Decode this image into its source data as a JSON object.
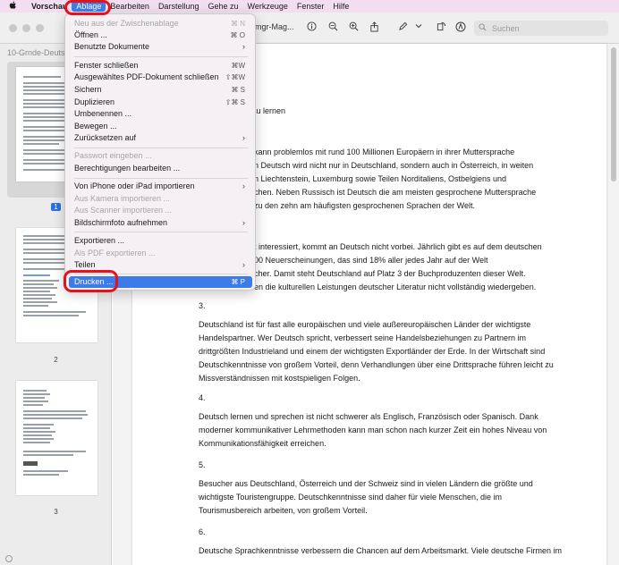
{
  "menubar": {
    "apple_icon": "apple-logo",
    "items": [
      "Vorschau",
      "Ablage",
      "Bearbeiten",
      "Darstellung",
      "Gehe zu",
      "Werkzeuge",
      "Fenster",
      "Hilfe"
    ]
  },
  "window": {
    "title": "mgr-Mag...",
    "search_placeholder": "Suchen"
  },
  "sidebar": {
    "title": "10-Grnde-Deuts",
    "pages": [
      "1",
      "2",
      "3"
    ]
  },
  "menu": {
    "neu": {
      "label": "Neu aus der Zwischenablage",
      "shortcut": "⌘ N"
    },
    "oeffnen": {
      "label": "Öffnen ...",
      "shortcut": "⌘ O"
    },
    "benutzte": {
      "label": "Benutzte Dokumente",
      "arrow": "›"
    },
    "fenster": {
      "label": "Fenster schließen",
      "shortcut": "⌘W"
    },
    "pdf_schliessen": {
      "label": "Ausgewähltes PDF-Dokument schließen",
      "shortcut": "⇧⌘W"
    },
    "sichern": {
      "label": "Sichern",
      "shortcut": "⌘ S"
    },
    "duplizieren": {
      "label": "Duplizieren",
      "shortcut": "⇧⌘ S"
    },
    "umbenennen": {
      "label": "Umbenennen ..."
    },
    "bewegen": {
      "label": "Bewegen ..."
    },
    "zuruecksetzen": {
      "label": "Zurücksetzen auf",
      "arrow": "›"
    },
    "passwort": {
      "label": "Passwort eingeben ..."
    },
    "berechtigungen": {
      "label": "Berechtigungen bearbeiten ..."
    },
    "iphone": {
      "label": "Von iPhone oder iPad importieren",
      "arrow": "›"
    },
    "kamera": {
      "label": "Aus Kamera importieren ..."
    },
    "scanner": {
      "label": "Aus Scanner importieren ..."
    },
    "bildschirmfoto": {
      "label": "Bildschirmfoto aufnehmen",
      "arrow": "›"
    },
    "exportieren": {
      "label": "Exportieren ..."
    },
    "als_pdf": {
      "label": "Als PDF exportieren ..."
    },
    "teilen": {
      "label": "Teilen",
      "arrow": "›"
    },
    "drucken": {
      "label": "Drucken ...",
      "shortcut": "⌘ P"
    }
  },
  "doc": {
    "l1": "zu lernen",
    "l2": "kann problemlos mit rund 100 Millionen Europäern in ihrer Muttersprache",
    "l3": "n Deutsch wird nicht nur in Deutschland, sondern auch in Österreich, in weiten",
    "l4": "n Liechtenstein, Luxemburg sowie Teilen Norditaliens, Ostbelgiens und",
    "l5": "chen. Neben Russisch ist Deutsch die am meisten gesprochene Muttersprache",
    "l6": "zu den zehn am häufigsten gesprochenen Sprachen der Welt.",
    "l7": "t interessiert, kommt an Deutsch nicht vorbei. Jährlich gibt es auf dem deutschen",
    "l8": "00 Neuerscheinungen, das sind 18% aller jedes Jahr auf der Welt",
    "l9": "cher. Damit steht Deutschland auf Platz 3 der Buchproduzenten dieser Welt.",
    "l10": "en die kulturellen Leistungen deutscher Literatur nicht vollständig wiedergeben.",
    "n3": "3.",
    "p3a": "Deutschland ist für fast alle europäischen und viele außereuropäischen Länder der wichtigste",
    "p3b": "Handelspartner. Wer Deutsch spricht, verbessert seine Handelsbeziehungen zu Partnern im",
    "p3c": "drittgrößten Industrieland und einem der wichtigsten Exportländer der Erde. In der Wirtschaft sind",
    "p3d": "Deutschkenntnisse von großem Vorteil, denn Verhandlungen über eine Drittsprache führen leicht zu",
    "p3e": "Missverständnissen mit kostspieligen Folgen.",
    "n4": "4.",
    "p4a": "Deutsch lernen und sprechen ist nicht schwerer als Englisch, Französisch oder Spanisch. Dank",
    "p4b": "moderner kommunikativer Lehrmethoden kann man schon nach kurzer Zeit ein hohes Niveau von",
    "p4c": "Kommunikationsfähigkeit erreichen.",
    "n5": "5.",
    "p5a": "Besucher aus Deutschland, Österreich und der Schweiz sind in vielen Ländern die größte und",
    "p5b": "wichtigste Touristengruppe. Deutschkenntnisse sind daher für viele Menschen, die im",
    "p5c": "Tourismusbereich arbeiten, von großem Vorteil.",
    "n6": "6.",
    "p6a": "Deutsche Sprachkenntnisse verbessern die Chancen auf dem Arbeitsmarkt. Viele deutsche Firmen im"
  },
  "colors": {
    "highlight": "#e3131d",
    "menu_selection": "#3d7bea"
  }
}
